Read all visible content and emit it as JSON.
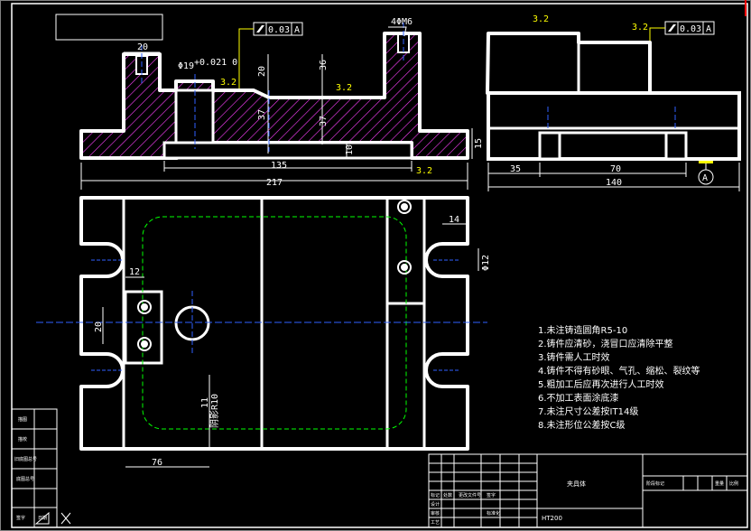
{
  "dimensions": {
    "front_top_left": "20",
    "thread": "4ΦM6",
    "flatness1": "0.03",
    "datum1": "A",
    "hole_dim": "Φ19",
    "hole_tol": "+0.021\n0",
    "rough1": "3.2",
    "rough2": "3.2",
    "rough3": "3.2",
    "rough_bottom": "3.2",
    "v20": "20",
    "v36": "36",
    "v37a": "37",
    "v37b": "37",
    "v10": "10",
    "h135": "135",
    "h217": "217",
    "side_rough": "3.2",
    "side_rough2": "3.2",
    "flatness2": "0.03",
    "datum2": "A",
    "v15": "15",
    "h35": "35",
    "h70": "70",
    "h140": "140",
    "datum_label": "A",
    "plan_14": "14",
    "plan_12": "Φ12",
    "plan_12b": "12",
    "plan_20": "20",
    "plan_11": "11",
    "plan_r10": "阴影R10",
    "plan_76": "76"
  },
  "notes": [
    "1.未注铸造圆角R5-10",
    "2.铸件应清砂，浇冒口应清除平整",
    "3.铸件需人工时效",
    "4.铸件不得有砂眼、气孔、缩松、裂纹等",
    "5.粗加工后应再次进行人工时效",
    "6.不加工表面涂底漆",
    "7.未注尺寸公差按IT14级",
    "8.未注形位公差按C级"
  ],
  "title_block": {
    "part_name": "夹具体",
    "material": "HT200",
    "row_labels": [
      "描图",
      "描校",
      "旧底图总号",
      "底图总号",
      "签字",
      "日期"
    ],
    "header_cells": [
      "标记",
      "处数",
      "更改文件号",
      "签字"
    ],
    "design_cells": [
      "设计",
      "审核",
      "工艺",
      "标准化"
    ],
    "right_cells": [
      "阶段标记",
      "重量",
      "比例"
    ]
  }
}
